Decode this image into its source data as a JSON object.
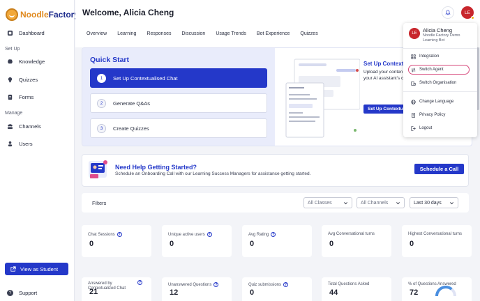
{
  "brand": {
    "name_part1": "Noodle",
    "name_part2": "Factory"
  },
  "sidebar": {
    "items": [
      {
        "label": "Dashboard",
        "icon": "dashboard-icon"
      },
      {
        "label": "Knowledge",
        "icon": "brain-icon"
      },
      {
        "label": "Quizzes",
        "icon": "lightbulb-icon"
      },
      {
        "label": "Forms",
        "icon": "form-icon"
      },
      {
        "label": "Channels",
        "icon": "users-icon"
      },
      {
        "label": "Users",
        "icon": "user-icon"
      }
    ],
    "sections": {
      "setup": "Set Up",
      "manage": "Manage"
    },
    "view_student": "View as Student",
    "support": "Support"
  },
  "header": {
    "welcome": "Welcome, Alicia Cheng",
    "avatar_initials": "LE",
    "tabs": [
      "Overview",
      "Learning",
      "Responses",
      "Discussion",
      "Usage Trends",
      "Bot Experience",
      "Quizzes"
    ]
  },
  "quick_start": {
    "title": "Quick Start",
    "steps": [
      {
        "num": "1",
        "label": "Set Up Contextualised Chat"
      },
      {
        "num": "2",
        "label": "Generate Q&As"
      },
      {
        "num": "3",
        "label": "Create Quizzes"
      }
    ],
    "right_title": "Set Up Contextu",
    "right_desc_line1": "Upload your conten",
    "right_desc_line2": "your AI assistant's c",
    "right_button": "Set Up Contextu"
  },
  "help": {
    "title": "Need Help Getting Started?",
    "subtitle": "Schedule an Onboarding Call with our Learning Success Managers for assistance getting started.",
    "button": "Schedule a Call"
  },
  "filters": {
    "label": "Filters",
    "classes": "All Classes",
    "channels": "All Channels",
    "range": "Last 30 days"
  },
  "stats_row1": [
    {
      "label": "Chat Sessions",
      "value": "0",
      "help": true
    },
    {
      "label": "Unique active users",
      "value": "0",
      "help": true
    },
    {
      "label": "Avg Rating",
      "value": "0",
      "help": true
    },
    {
      "label": "Avg Conversational turns",
      "value": "0",
      "help": false
    },
    {
      "label": "Highest Conversational turns",
      "value": "0",
      "help": false
    }
  ],
  "stats_row2": [
    {
      "label": "Answered by Contextualized Chat",
      "value": "21",
      "help": true
    },
    {
      "label": "Unanswered Questions",
      "value": "12",
      "help": true
    },
    {
      "label": "Quiz submissions",
      "value": "0",
      "help": true
    },
    {
      "label": "Total Questions Asked",
      "value": "44",
      "help": false
    },
    {
      "label": "% of Questions Answered",
      "value": "72",
      "help": false,
      "gauge_fraction": 0.72
    }
  ],
  "menu": {
    "avatar_initials": "LE",
    "name": "Alicia Cheng",
    "org": "Noodle Factory Demo Learning Bot",
    "items": [
      {
        "label": "Integration",
        "icon": "integration-icon"
      },
      {
        "label": "Switch Agent",
        "icon": "switch-icon"
      },
      {
        "label": "Switch Organisation",
        "icon": "building-icon"
      },
      {
        "label": "Change Language",
        "icon": "globe-icon"
      },
      {
        "label": "Privacy Policy",
        "icon": "document-icon"
      },
      {
        "label": "Logout",
        "icon": "logout-icon"
      }
    ]
  },
  "colors": {
    "primary": "#2438c9",
    "avatar": "#c8262c",
    "highlight": "#d6477a"
  }
}
